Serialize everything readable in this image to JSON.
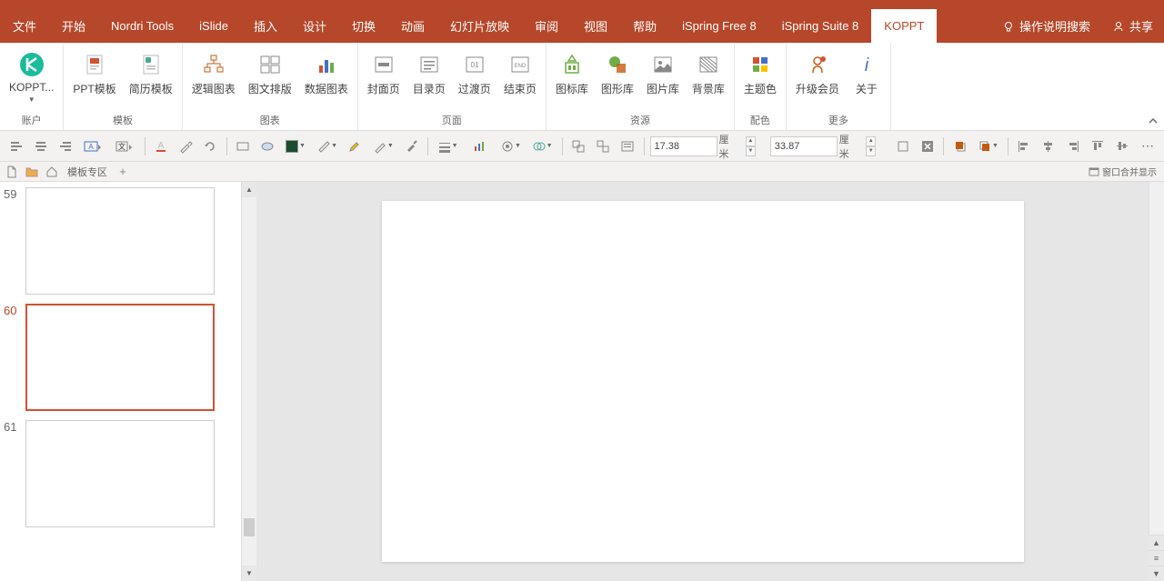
{
  "menu": {
    "items": [
      "文件",
      "开始",
      "Nordri Tools",
      "iSlide",
      "插入",
      "设计",
      "切换",
      "动画",
      "幻灯片放映",
      "审阅",
      "视图",
      "帮助",
      "iSpring Free 8",
      "iSpring Suite 8",
      "KOPPT"
    ],
    "active": "KOPPT",
    "search_hint": "操作说明搜索",
    "share": "共享"
  },
  "ribbon": {
    "groups": [
      {
        "label": "账户",
        "items": [
          {
            "label": "KOPPT...",
            "icon": "koppt-logo"
          }
        ]
      },
      {
        "label": "模板",
        "items": [
          {
            "label": "PPT模板",
            "icon": "ppt-template"
          },
          {
            "label": "简历模板",
            "icon": "resume-template"
          }
        ]
      },
      {
        "label": "图表",
        "items": [
          {
            "label": "逻辑图表",
            "icon": "logic-chart"
          },
          {
            "label": "图文排版",
            "icon": "layout-chart"
          },
          {
            "label": "数据图表",
            "icon": "data-chart"
          }
        ]
      },
      {
        "label": "页面",
        "items": [
          {
            "label": "封面页",
            "icon": "cover-page"
          },
          {
            "label": "目录页",
            "icon": "toc-page"
          },
          {
            "label": "过渡页",
            "icon": "transition-page"
          },
          {
            "label": "结束页",
            "icon": "end-page"
          }
        ]
      },
      {
        "label": "资源",
        "items": [
          {
            "label": "图标库",
            "icon": "icon-lib"
          },
          {
            "label": "图形库",
            "icon": "shape-lib"
          },
          {
            "label": "图片库",
            "icon": "image-lib"
          },
          {
            "label": "背景库",
            "icon": "bg-lib"
          }
        ]
      },
      {
        "label": "配色",
        "items": [
          {
            "label": "主题色",
            "icon": "theme-color"
          }
        ]
      },
      {
        "label": "更多",
        "items": [
          {
            "label": "升级会员",
            "icon": "upgrade"
          },
          {
            "label": "关于",
            "icon": "about"
          }
        ]
      }
    ]
  },
  "qat": {
    "width_value": "17.38",
    "height_value": "33.87",
    "unit": "厘米"
  },
  "tab_strip": {
    "template_zone": "模板专区",
    "merge_hint": "窗口合并显示"
  },
  "slides": {
    "visible": [
      {
        "num": "59",
        "selected": false
      },
      {
        "num": "60",
        "selected": true
      },
      {
        "num": "61",
        "selected": false
      }
    ]
  }
}
